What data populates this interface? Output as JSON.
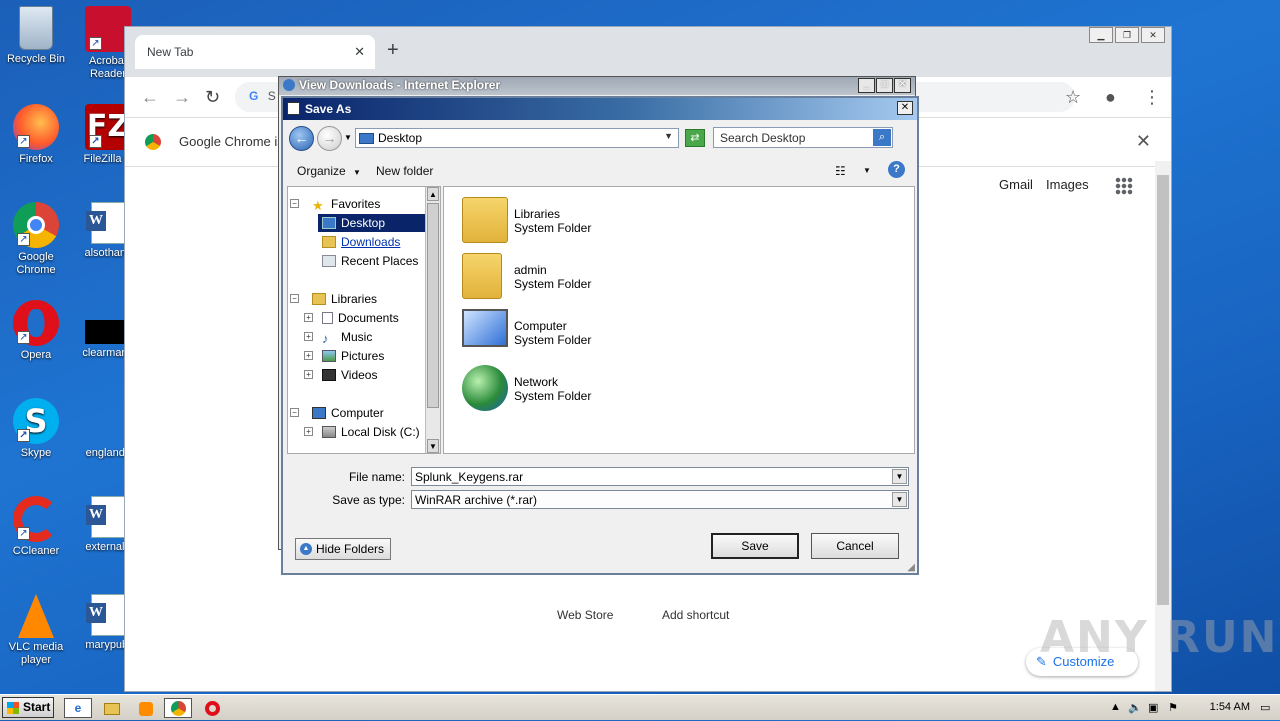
{
  "desktop": {
    "icons": [
      {
        "label": "Recycle Bin"
      },
      {
        "label": "Acrobat Reader"
      },
      {
        "label": "Firefox"
      },
      {
        "label": "FileZilla C"
      },
      {
        "label": "Google Chrome"
      },
      {
        "label": "alsothank"
      },
      {
        "label": "Opera"
      },
      {
        "label": "clearmann"
      },
      {
        "label": "Skype"
      },
      {
        "label": "englands"
      },
      {
        "label": "CCleaner"
      },
      {
        "label": "externala"
      },
      {
        "label": "VLC media player"
      },
      {
        "label": "marypubl"
      }
    ]
  },
  "chrome": {
    "tab_title": "New Tab",
    "tab_close": "✕",
    "new_tab": "+",
    "omnibox_text": "S",
    "infobar_text": "Google Chrome is",
    "infobar_close": "✕",
    "header_links": [
      "Gmail",
      "Images"
    ],
    "shortcuts": [
      "Web Store",
      "Add shortcut"
    ],
    "customize_label": "Customize"
  },
  "ie_window": {
    "title": "View Downloads - Internet Explorer",
    "buttons": [
      "_",
      "□",
      "✕"
    ]
  },
  "save_dialog": {
    "title": "Save As",
    "address": "Desktop",
    "search_placeholder": "Search Desktop",
    "organize_label": "Organize",
    "new_folder_label": "New folder",
    "nav": {
      "favorites": "Favorites",
      "desktop": "Desktop",
      "downloads": "Downloads",
      "recent_places": "Recent Places",
      "libraries": "Libraries",
      "documents": "Documents",
      "music": "Music",
      "pictures": "Pictures",
      "videos": "Videos",
      "computer": "Computer",
      "local_disk": "Local Disk (C:)"
    },
    "items": [
      {
        "name": "Libraries",
        "type": "System Folder"
      },
      {
        "name": "admin",
        "type": "System Folder"
      },
      {
        "name": "Computer",
        "type": "System Folder"
      },
      {
        "name": "Network",
        "type": "System Folder"
      }
    ],
    "file_name_label": "File name:",
    "file_name_value": "Splunk_Keygens.rar",
    "save_type_label": "Save as type:",
    "save_type_value": "WinRAR archive (*.rar)",
    "hide_folders_label": "Hide Folders",
    "save_label": "Save",
    "cancel_label": "Cancel"
  },
  "taskbar": {
    "start_label": "Start",
    "clock": "1:54 AM"
  },
  "watermark": "ANY RUN"
}
